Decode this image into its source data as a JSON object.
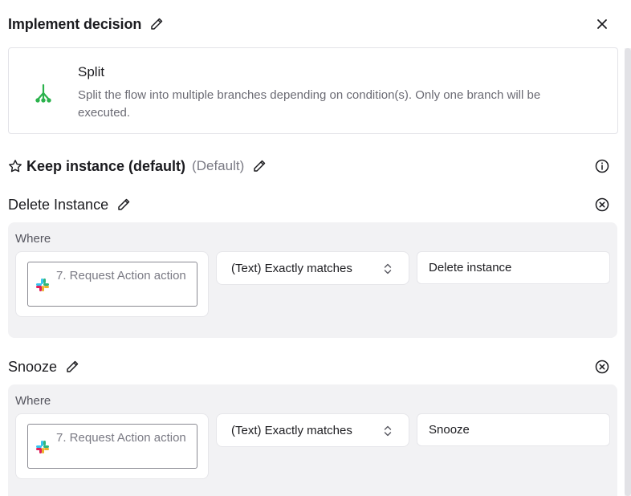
{
  "header": {
    "title": "Implement decision"
  },
  "split": {
    "title": "Split",
    "description": "Split the flow into multiple branches depending on condition(s). Only one branch will be executed.",
    "icon": "split-branch-icon",
    "icon_color": "#2bb24c"
  },
  "default_branch": {
    "name": "Keep instance (default)",
    "tag": "(Default)"
  },
  "branches": [
    {
      "name": "Delete Instance",
      "where_label": "Where",
      "field": "7. Request Action action",
      "operator": "(Text) Exactly matches",
      "value": "Delete instance"
    },
    {
      "name": "Snooze",
      "where_label": "Where",
      "field": "7. Request Action action",
      "operator": "(Text) Exactly matches",
      "value": "Snooze"
    }
  ]
}
